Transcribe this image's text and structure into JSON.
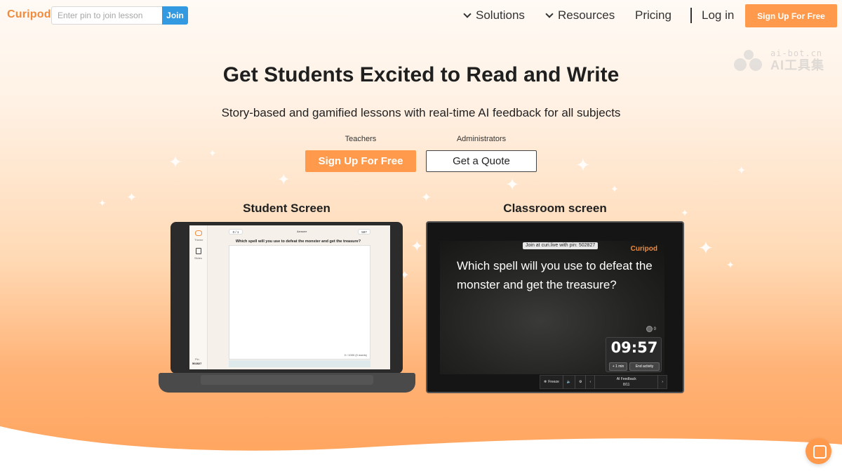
{
  "nav": {
    "logo": "Curipod",
    "pin_placeholder": "Enter pin to join lesson",
    "join_label": "Join",
    "solutions": "Solutions",
    "resources": "Resources",
    "pricing": "Pricing",
    "login": "Log in",
    "signup": "Sign Up For Free"
  },
  "watermark": {
    "line1": "ai-bot.cn",
    "line2": "AI工具集"
  },
  "hero": {
    "title": "Get Students Excited to Read and Write",
    "subtitle": "Story-based and gamified lessons with real-time AI feedback for all subjects",
    "teachers_label": "Teachers",
    "admins_label": "Administrators",
    "signup_label": "Sign Up For Free",
    "quote_label": "Get a Quote"
  },
  "student": {
    "label": "Student Screen",
    "tab_label": "Theme",
    "slides_label": "Slides",
    "page_count": "0 / 1",
    "answer_label": "Answer",
    "score": "597",
    "question": "Which spell will you use to defeat the monster and get the treasure?",
    "word_count": "0 / 1000 (0 words)",
    "pin_label": "Pin",
    "pin": "502827"
  },
  "classroom": {
    "label": "Classroom screen",
    "join_text": "Join at curi.live with pin: 502827",
    "logo": "Curipod",
    "question": "Which spell will you use to defeat the monster and get the treasure?",
    "participants": "0",
    "timer": "09:57",
    "add_min": "+ 1 min",
    "end_activity": "End activity",
    "freeze": "Freeze",
    "feedback_title": "AI Feedback",
    "feedback_page": "8/11"
  },
  "colors": {
    "brand_orange": "#ff9a4d",
    "join_blue": "#3399e0"
  }
}
